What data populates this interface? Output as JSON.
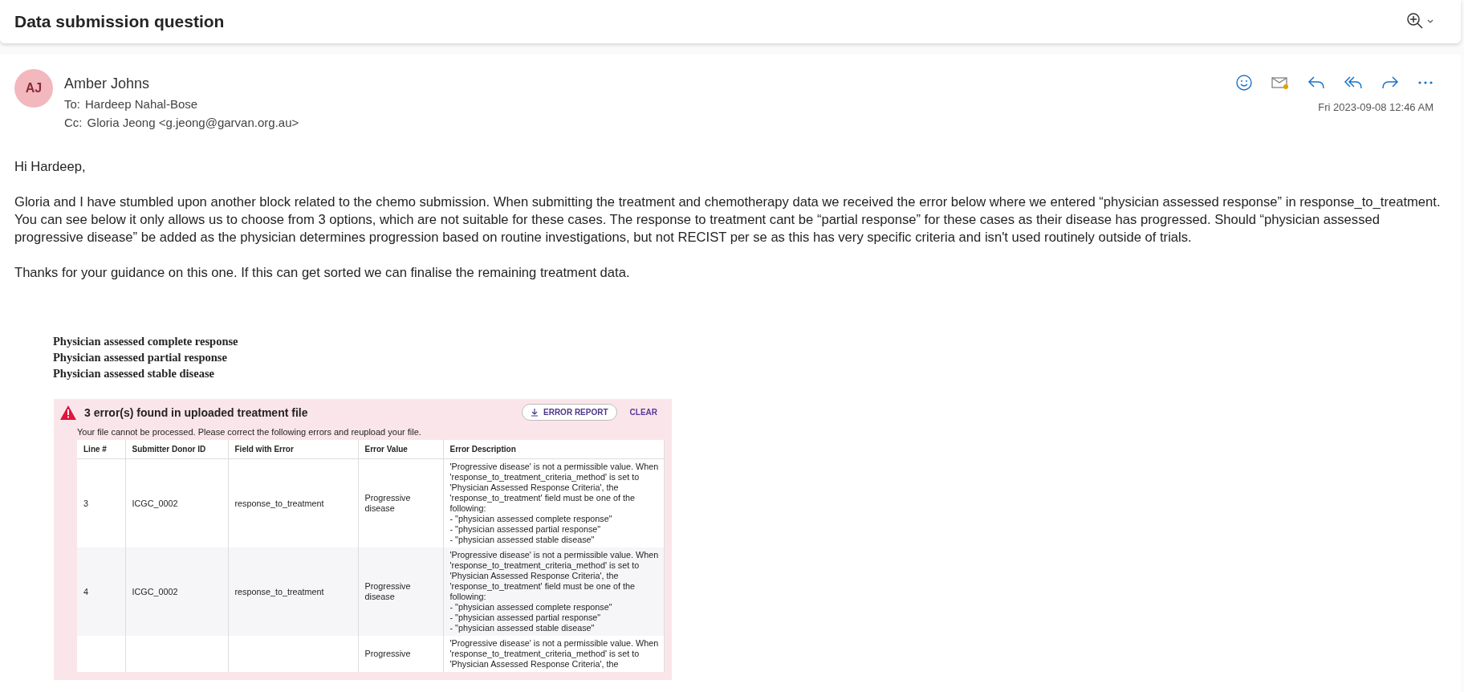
{
  "subject": "Data submission question",
  "message": {
    "avatar": "AJ",
    "sender": "Amber Johns",
    "to_label": "To:",
    "to": "Hardeep Nahal-Bose",
    "cc_label": "Cc:",
    "cc": "Gloria Jeong <g.jeong@garvan.org.au>",
    "date": "Fri 2023-09-08 12:46 AM"
  },
  "body": [
    "Hi Hardeep,",
    "Gloria and I have stumbled upon another block related to the chemo submission. When submitting the treatment and chemotherapy data we received the error below where we entered “physician assessed response” in response_to_treatment. You can see below it only allows us to choose from 3 options, which are not suitable for these cases.  The response to treatment cant be “partial response” for these cases as their disease has progressed. Should “physician assessed progressive disease” be added as the physician determines progression based on routine investigations, but not RECIST per se as this has very specific criteria and isn't used routinely outside of trials.",
    "Thanks for your guidance on this one. If this can get sorted we can finalise the remaining treatment data."
  ],
  "options": [
    "Physician assessed complete response",
    "Physician assessed partial response",
    "Physician assessed stable disease"
  ],
  "error_panel": {
    "title": "3 error(s) found in uploaded treatment file",
    "report_button": "ERROR REPORT",
    "clear_button": "CLEAR",
    "message": "Your file cannot be processed. Please correct the following errors and reupload your file.",
    "columns": [
      "Line #",
      "Submitter Donor ID",
      "Field with Error",
      "Error Value",
      "Error Description"
    ],
    "rows": [
      {
        "line": "3",
        "donor_id": "ICGC_0002",
        "field": "response_to_treatment",
        "value": "Progressive disease",
        "description": [
          "'Progressive disease' is not a permissible value. When",
          "'response_to_treatment_criteria_method' is set to",
          "'Physician Assessed Response Criteria', the",
          "'response_to_treatment' field must be one of the",
          "following:",
          "- \"physician assessed complete response\"",
          "- \"physician assessed partial response\"",
          "- \"physician assessed stable disease\""
        ]
      },
      {
        "line": "4",
        "donor_id": "ICGC_0002",
        "field": "response_to_treatment",
        "value": "Progressive disease",
        "description": [
          "'Progressive disease' is not a permissible value. When",
          "'response_to_treatment_criteria_method' is set to",
          "'Physician Assessed Response Criteria', the",
          "'response_to_treatment' field must be one of the",
          "following:",
          "- \"physician assessed complete response\"",
          "- \"physician assessed partial response\"",
          "- \"physician assessed stable disease\""
        ]
      },
      {
        "value": "Progressive",
        "description": [
          "'Progressive disease' is not a permissible value. When",
          "'response_to_treatment_criteria_method' is set to",
          "'Physician Assessed Response Criteria', the"
        ]
      }
    ]
  }
}
